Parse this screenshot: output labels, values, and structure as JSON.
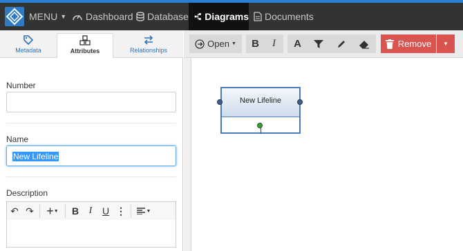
{
  "navbar": {
    "menu_label": "MENU",
    "items": [
      {
        "label": "Dashboard",
        "icon": "speedometer-icon"
      },
      {
        "label": "Database",
        "icon": "database-icon"
      },
      {
        "label": "Diagrams",
        "icon": "sitemap-icon",
        "active": true
      },
      {
        "label": "Documents",
        "icon": "document-icon"
      }
    ]
  },
  "left_panel": {
    "tabs": [
      {
        "label": "Metadata",
        "icon": "tag-icon"
      },
      {
        "label": "Attributes",
        "icon": "cubes-icon",
        "active": true
      },
      {
        "label": "Relationships",
        "icon": "exchange-icon"
      }
    ],
    "fields": {
      "number": {
        "label": "Number",
        "value": ""
      },
      "name": {
        "label": "Name",
        "value": "New Lifeline"
      },
      "description": {
        "label": "Description",
        "value": ""
      }
    }
  },
  "toolbar": {
    "open_label": "Open",
    "bold_label": "B",
    "italic_label": "I",
    "font_label": "A",
    "remove_label": "Remove"
  },
  "canvas": {
    "lifeline_label": "New Lifeline"
  },
  "colors": {
    "accent": "#2b7fd4",
    "navbar_bg": "#333333",
    "remove_red": "#d9534f",
    "lifeline_border": "#4a7bbf"
  }
}
